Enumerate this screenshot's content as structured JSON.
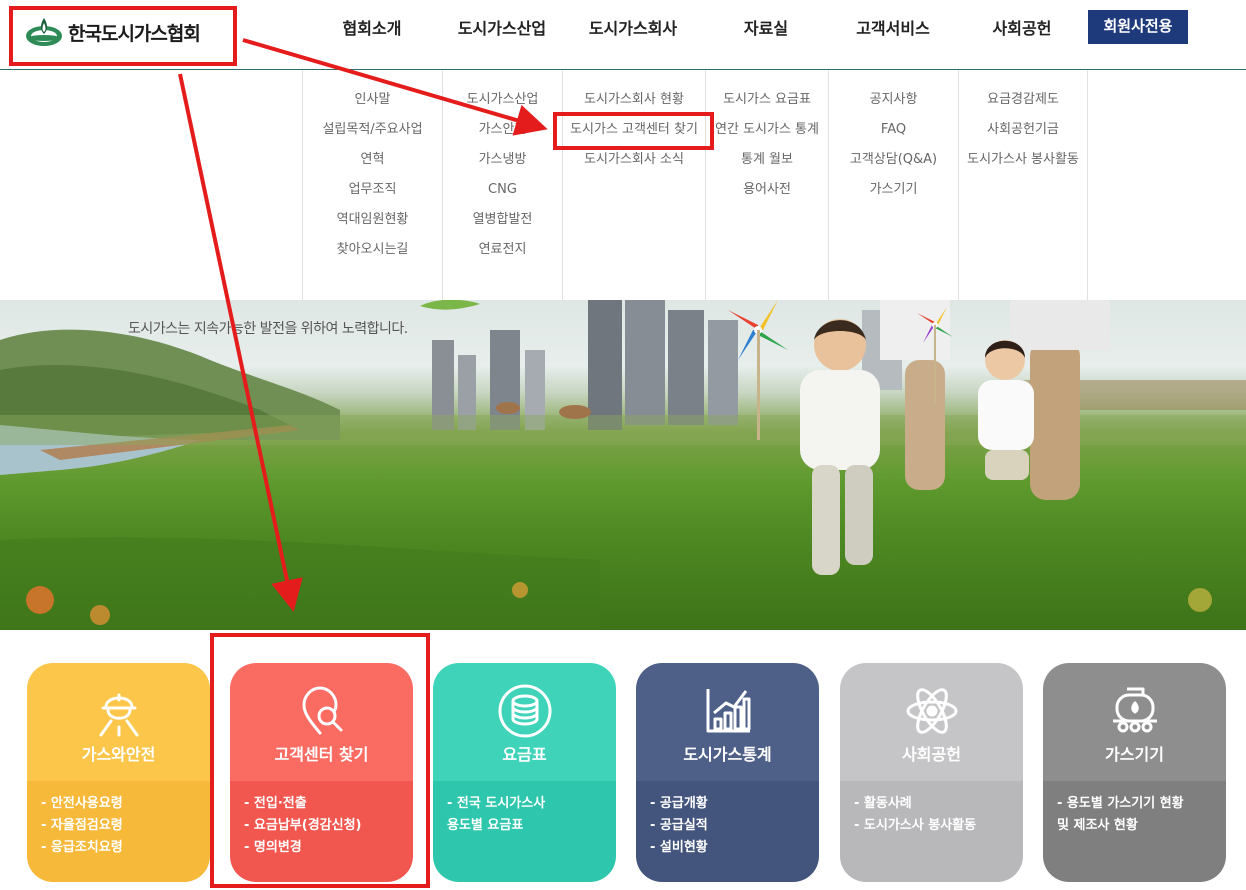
{
  "header": {
    "logo_text": "한국도시가스협회",
    "nav": [
      {
        "label": "협회소개"
      },
      {
        "label": "도시가스산업"
      },
      {
        "label": "도시가스회사"
      },
      {
        "label": "자료실"
      },
      {
        "label": "고객서비스"
      },
      {
        "label": "사회공헌"
      }
    ],
    "member_label": "회원사전용"
  },
  "mega_menu": {
    "columns": [
      {
        "items": [
          "인사말",
          "설립목적/주요사업",
          "연혁",
          "업무조직",
          "역대임원현황",
          "찾아오시는길"
        ]
      },
      {
        "items": [
          "도시가스산업",
          "가스안전",
          "가스냉방",
          "CNG",
          "열병합발전",
          "연료전지"
        ]
      },
      {
        "items": [
          "도시가스회사 현황",
          "도시가스 고객센터 찾기",
          "도시가스회사 소식"
        ]
      },
      {
        "items": [
          "도시가스 요금표",
          "연간 도시가스 통계",
          "통계 월보",
          "용어사전"
        ]
      },
      {
        "items": [
          "공지사항",
          "FAQ",
          "고객상담(Q&A)",
          "가스기기"
        ]
      },
      {
        "items": [
          "요금경감제도",
          "사회공헌기금",
          "도시가스사 봉사활동"
        ]
      }
    ]
  },
  "banner": {
    "slogan": "도시가스는 지속가능한 발전을 위하여 노력합니다."
  },
  "tiles": [
    {
      "title": "가스와안전",
      "icon": "worker-helmet-icon",
      "items": [
        "- 안전사용요령",
        "- 자율점검요령",
        "- 응급조치요령"
      ],
      "top_color": "#fcc64a",
      "bottom_color": "#f7b93a"
    },
    {
      "title": "고객센터 찾기",
      "icon": "location-search-icon",
      "items": [
        "- 전입·전출",
        "- 요금납부(경감신청)",
        "- 명의변경"
      ],
      "top_color": "#fa6b62",
      "bottom_color": "#f2574f"
    },
    {
      "title": "요금표",
      "icon": "coin-stack-icon",
      "items": [
        "- 전국 도시가스사",
        "용도별 요금표"
      ],
      "top_color": "#3fd3b9",
      "bottom_color": "#2ec7ad"
    },
    {
      "title": "도시가스통계",
      "icon": "bar-chart-icon",
      "items": [
        "- 공급개황",
        "- 공급실적",
        "- 설비현황"
      ],
      "top_color": "#4e5f88",
      "bottom_color": "#43547d"
    },
    {
      "title": "사회공헌",
      "icon": "atom-icon",
      "items": [
        "- 활동사례",
        "- 도시가스사 봉사활동"
      ],
      "top_color": "#c5c5c7",
      "bottom_color": "#b8b8bb"
    },
    {
      "title": "가스기기",
      "icon": "gas-tank-truck-icon",
      "items": [
        "- 용도별 가스기기 현황",
        "및 제조사 현황"
      ],
      "top_color": "#8e8e8e",
      "bottom_color": "#7f7f7f"
    }
  ],
  "colors": {
    "annotation": "#e51c1c",
    "member_button": "#1e3a7b",
    "header_line": "#2f6e6a"
  }
}
